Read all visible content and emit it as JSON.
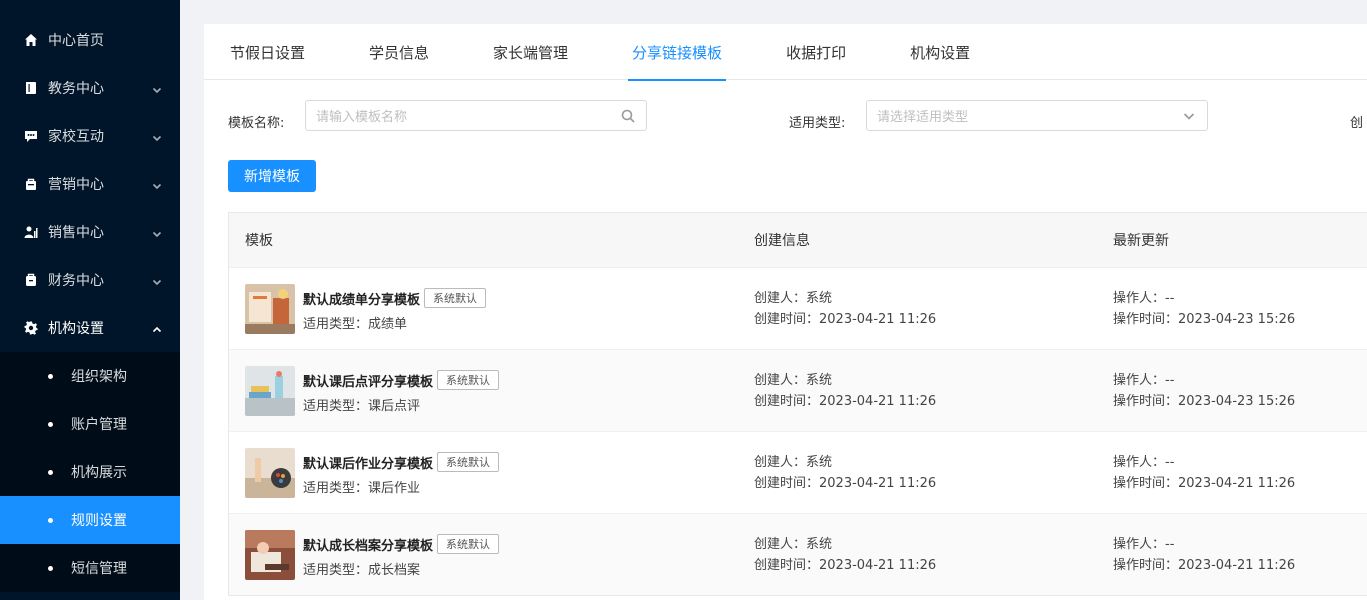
{
  "sidebar": {
    "items": [
      {
        "label": "中心首页",
        "icon": "home-icon"
      },
      {
        "label": "教务中心",
        "icon": "book-icon"
      },
      {
        "label": "家校互动",
        "icon": "chat-icon"
      },
      {
        "label": "营销中心",
        "icon": "bag-icon"
      },
      {
        "label": "销售中心",
        "icon": "chart-person-icon"
      },
      {
        "label": "财务中心",
        "icon": "wallet-icon"
      },
      {
        "label": "机构设置",
        "icon": "gear-icon"
      }
    ],
    "sub_items": [
      "组织架构",
      "账户管理",
      "机构展示",
      "规则设置",
      "短信管理"
    ],
    "active_sub": "规则设置"
  },
  "tabs": [
    "节假日设置",
    "学员信息",
    "家长端管理",
    "分享链接模板",
    "收据打印",
    "机构设置"
  ],
  "active_tab": "分享链接模板",
  "filters": {
    "name_label": "模板名称:",
    "name_placeholder": "请输入模板名称",
    "type_label": "适用类型:",
    "type_placeholder": "请选择适用类型",
    "third_label_partial": "创"
  },
  "add_button": "新增模板",
  "table": {
    "headers": [
      "模板",
      "创建信息",
      "最新更新"
    ],
    "rows": [
      {
        "name": "默认成绩单分享模板",
        "badge": "系统默认",
        "type": "适用类型：成绩单",
        "creator": "创建人：系统",
        "created": "创建时间：2023-04-21 11:26",
        "operator": "操作人：--",
        "updated": "操作时间：2023-04-23 15:26"
      },
      {
        "name": "默认课后点评分享模板",
        "badge": "系统默认",
        "type": "适用类型：课后点评",
        "creator": "创建人：系统",
        "created": "创建时间：2023-04-21 11:26",
        "operator": "操作人：--",
        "updated": "操作时间：2023-04-23 15:26"
      },
      {
        "name": "默认课后作业分享模板",
        "badge": "系统默认",
        "type": "适用类型：课后作业",
        "creator": "创建人：系统",
        "created": "创建时间：2023-04-21 11:26",
        "operator": "操作人：--",
        "updated": "操作时间：2023-04-21 11:26"
      },
      {
        "name": "默认成长档案分享模板",
        "badge": "系统默认",
        "type": "适用类型：成长档案",
        "creator": "创建人：系统",
        "created": "创建时间：2023-04-21 11:26",
        "operator": "操作人：--",
        "updated": "操作时间：2023-04-21 11:26"
      }
    ]
  },
  "colors": {
    "sidebar_bg": "#001529",
    "submenu_bg": "#000c17",
    "primary": "#1890ff"
  }
}
